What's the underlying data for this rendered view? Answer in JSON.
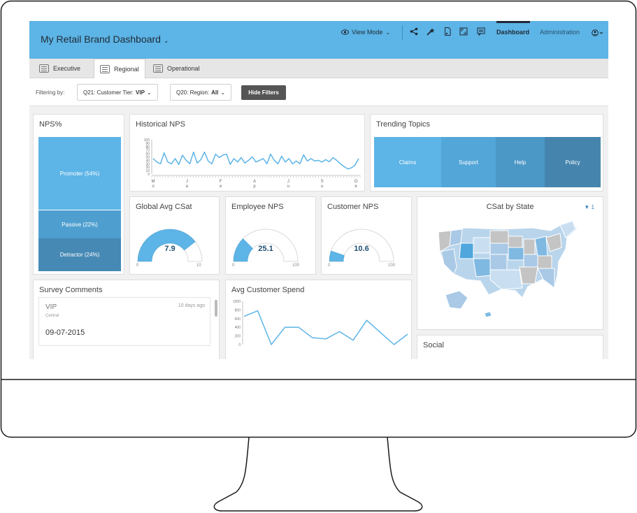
{
  "header": {
    "title": "My Retail Brand Dashboard",
    "view_mode": "View Mode",
    "nav": {
      "dashboard": "Dashboard",
      "administration": "Administration"
    }
  },
  "tabs": [
    {
      "label": "Executive",
      "active": false
    },
    {
      "label": "Regional",
      "active": true
    },
    {
      "label": "Operational",
      "active": false
    }
  ],
  "filters": {
    "label": "Filtering by:",
    "chip1_prefix": "Q21: Customer Tier:",
    "chip1_value": "VIP",
    "chip2_prefix": "Q20: Region:",
    "chip2_value": "All",
    "hide_button": "Hide Filters"
  },
  "nps_percent": {
    "title": "NPS%",
    "promoter": "Promoter (54%)",
    "passive": "Passive (22%)",
    "detractor": "Detractor (24%)"
  },
  "historical_nps": {
    "title": "Historical NPS",
    "y_ticks": [
      "100",
      "90",
      "80",
      "70",
      "60",
      "50",
      "40",
      "30",
      "20",
      "10",
      "0"
    ],
    "x_ticks_top": [
      "M",
      "J",
      "F",
      "A",
      "J",
      "S",
      "O"
    ],
    "x_ticks_bottom": [
      "o",
      "a",
      "e",
      "p",
      "u",
      "u",
      "e"
    ]
  },
  "trending_topics": {
    "title": "Trending Topics",
    "topics": [
      {
        "label": "Claims",
        "color": "#5db4e6"
      },
      {
        "label": "Support",
        "color": "#53a6d8"
      },
      {
        "label": "Help",
        "color": "#4b97c6"
      },
      {
        "label": "Policy",
        "color": "#4585ad"
      }
    ]
  },
  "gauges": [
    {
      "title": "Global Avg CSat",
      "value": "7.9",
      "min": "0",
      "max": "10",
      "fraction": 0.79
    },
    {
      "title": "Employee NPS",
      "value": "25.1",
      "min": "0",
      "max": "100",
      "fraction": 0.251
    },
    {
      "title": "Customer NPS",
      "value": "10.6",
      "min": "0",
      "max": "100",
      "fraction": 0.106
    }
  ],
  "csat_by_state": {
    "title": "CSat by State",
    "filter_count": "1"
  },
  "survey_comments": {
    "title": "Survey Comments",
    "card": {
      "tier": "VIP",
      "region": "Central",
      "date": "09-07-2015",
      "ago": "10 days ago"
    }
  },
  "avg_customer_spend": {
    "title": "Avg Customer Spend",
    "y_ticks": [
      "1000",
      "800",
      "600",
      "400",
      "200",
      "0"
    ]
  },
  "social": {
    "title": "Social"
  },
  "colors": {
    "brand_blue": "#5db4e6",
    "dark_text": "#1e2a35"
  },
  "chart_data": [
    {
      "type": "line",
      "title": "Historical NPS",
      "ylim": [
        0,
        100
      ],
      "values": [
        45,
        35,
        30,
        62,
        35,
        30,
        45,
        28,
        55,
        40,
        30,
        64,
        32,
        42,
        64,
        38,
        30,
        58,
        48,
        55,
        58,
        28,
        45,
        35,
        48,
        32,
        40,
        50,
        35,
        40,
        45,
        30,
        58,
        40,
        30,
        52,
        35,
        45,
        30,
        38,
        30,
        56,
        38,
        45,
        38,
        40,
        35,
        42,
        36,
        48,
        40,
        30,
        22,
        15,
        18,
        26,
        45
      ]
    },
    {
      "type": "line",
      "title": "Avg Customer Spend",
      "ylim": [
        0,
        1000
      ],
      "values": [
        650,
        780,
        0,
        400,
        400,
        160,
        130,
        300,
        100,
        560,
        280,
        0,
        240
      ]
    }
  ]
}
